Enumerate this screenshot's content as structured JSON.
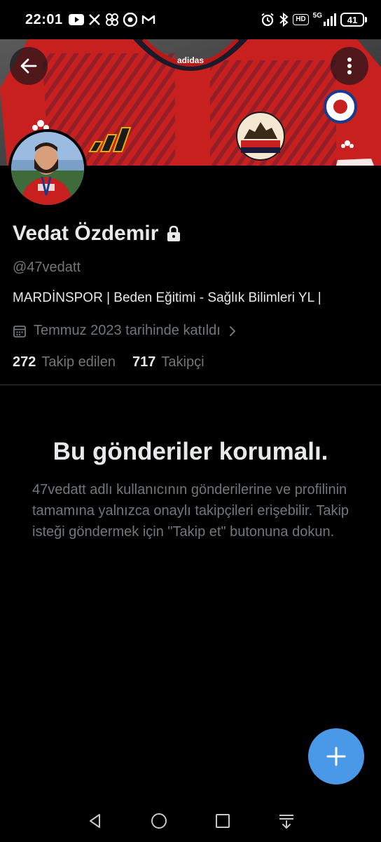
{
  "status_bar": {
    "time": "22:01",
    "left_icons": [
      "youtube-icon",
      "x-icon",
      "pinwheel-icon",
      "chrome-icon",
      "gmail-icon"
    ],
    "right_icons": [
      "alarm-icon",
      "bluetooth-icon",
      "hd-badge",
      "5g-signal-icon"
    ],
    "hd_label": "HD",
    "network_label": "5G",
    "battery_level": "41"
  },
  "profile": {
    "display_name": "Vedat Özdemir",
    "handle": "@47vedatt",
    "bio": "MARDİNSPOR | Beden Eğitimi - Sağlık Bilimleri YL |",
    "join_date": "Temmuz 2023 tarihinde katıldı",
    "following_count": "272",
    "following_label": "Takip edilen",
    "followers_count": "717",
    "followers_label": "Takipçi"
  },
  "protected": {
    "title": "Bu gönderiler korumalı.",
    "description": "47vedatt adlı kullanıcının gönderilerine ve profilinin tamamına yalnızca onaylı takipçileri erişebilir. Takip isteği göndermek için \"Takip et\" butonuna dokun."
  },
  "banner": {
    "jersey_brand": "adidas"
  },
  "colors": {
    "accent": "#4a99e9",
    "text_primary": "#e7e9ea",
    "text_secondary": "#71767b",
    "background": "#000000",
    "jersey_red": "#c8201e"
  }
}
